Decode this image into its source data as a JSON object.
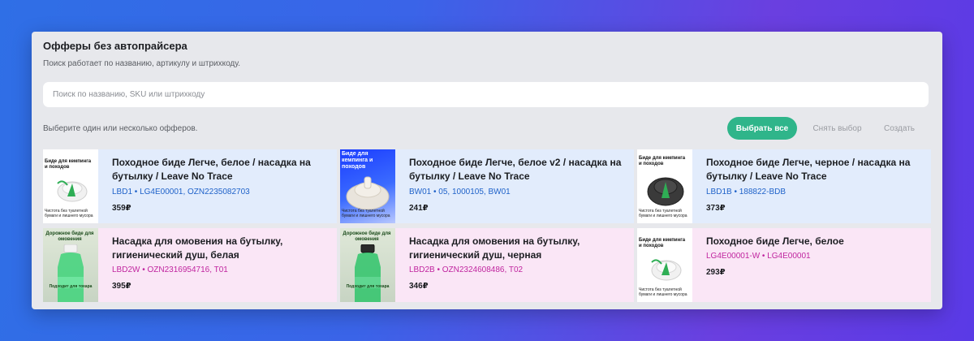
{
  "header": {
    "title": "Офферы без автопрайсера",
    "subtitle": "Поиск работает по названию, артикулу и штрихкоду."
  },
  "search": {
    "placeholder": "Поиск по названию, SKU или штрихкоду",
    "value": ""
  },
  "selection": {
    "hint": "Выберите один или несколько офферов.",
    "select_all": "Выбрать все",
    "clear": "Снять выбор",
    "create": "Создать"
  },
  "offers": [
    {
      "title": "Походное биде Легче, белое / насадка на бутылку / Leave No Trace",
      "sku": "LBD1 • LG4E00001, OZN2235082703",
      "price": "359₽",
      "thumb": {
        "text": "Биде для кемпинга и походов",
        "foot": "Чистота без туалетной бумаги и лишнего мусора",
        "cap": "white"
      }
    },
    {
      "title": "Походное биде Легче, белое v2 / насадка на бутылку / Leave No Trace",
      "sku": "BW01 • 05, 1000105, BW01",
      "price": "241₽",
      "thumb": {
        "text": "Биде для кемпинга и походов",
        "foot": "Чистота без туалетной бумаги и лишнего мусора",
        "cap": "white"
      }
    },
    {
      "title": "Походное биде Легче, черное / насадка на бутылку / Leave No Trace",
      "sku": "LBD1B • 188822-BDB",
      "price": "373₽",
      "thumb": {
        "text": "Биде для кемпинга и походов",
        "foot": "Чистота без туалетной бумаги и лишнего мусора",
        "cap": "black"
      }
    },
    {
      "title": "Насадка для омовения на бутылку, гигиенический душ, белая",
      "sku": "LBD2W • OZN2316954716, T01",
      "price": "395₽",
      "thumb": {
        "text": "Дорожное биде для омовения",
        "foot": "Подходит для тохара",
        "cap": "white"
      }
    },
    {
      "title": "Насадка для омовения на бутылку, гигиенический душ, черная",
      "sku": "LBD2B • OZN2324608486, T02",
      "price": "346₽",
      "thumb": {
        "text": "Дорожное биде для омовения",
        "foot": "Подходит для тохара",
        "cap": "black"
      }
    },
    {
      "title": "Походное биде Легче, белое",
      "sku": "LG4E00001-W • LG4E00001",
      "price": "293₽",
      "thumb": {
        "text": "Биде для кемпинга и походов",
        "foot": "Чистота без туалетной бумаги и лишнего мусора",
        "cap": "white"
      }
    }
  ],
  "colors": {
    "primary_button": "#2fb58a",
    "card_blue": "#e2ecfc",
    "card_pink": "#fae6f6",
    "sku_blue": "#1f62c9",
    "sku_pink": "#c0259f"
  }
}
